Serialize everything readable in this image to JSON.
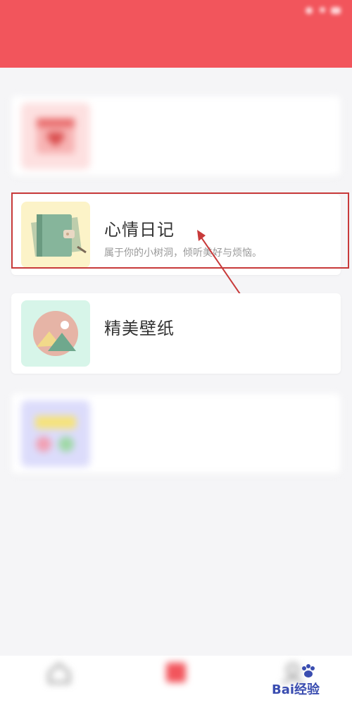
{
  "status_bar": {
    "left": "",
    "time": ""
  },
  "header": {
    "title": ""
  },
  "cards": [
    {
      "title": "",
      "desc": "",
      "icon": "calendar-heart-icon"
    },
    {
      "title": "心情日记",
      "desc": "属于你的小树洞，倾听美好与烦恼。",
      "icon": "diary-book-icon"
    },
    {
      "title": "精美壁纸",
      "desc": "",
      "icon": "landscape-picture-icon"
    },
    {
      "title": "",
      "desc": "",
      "icon": "widgets-icon"
    }
  ],
  "bottom_nav": [
    {
      "label": "",
      "icon": "home-icon"
    },
    {
      "label": "",
      "icon": "grid-icon"
    },
    {
      "label": "",
      "icon": "profile-icon"
    }
  ],
  "watermark": {
    "text": "Bai经验"
  },
  "colors": {
    "header": "#f2555c",
    "highlight": "#c83a3a",
    "thumb_pink": "#fde0e0",
    "thumb_yellow": "#fcf3c8",
    "thumb_mint": "#d7f5e9",
    "thumb_lavender": "#dcdcfb"
  }
}
